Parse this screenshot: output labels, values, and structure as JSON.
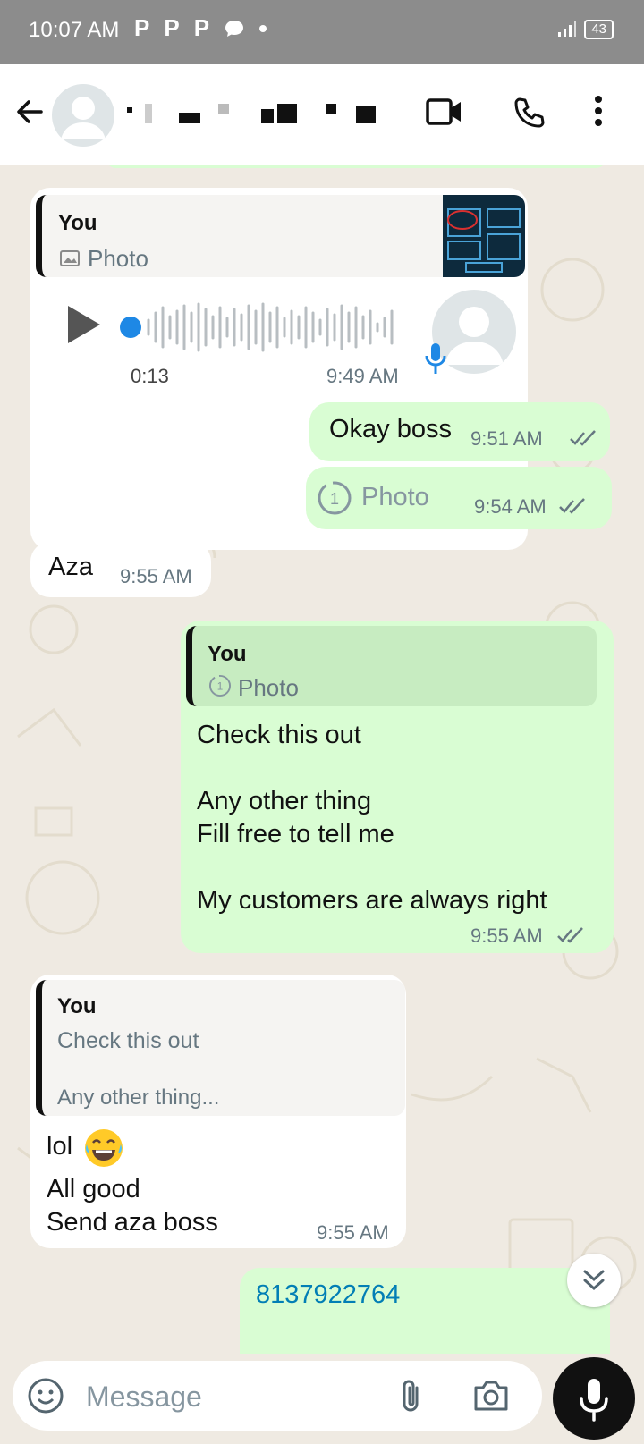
{
  "status": {
    "time": "10:07 AM",
    "notif_letter": "P",
    "battery": "43"
  },
  "header": {
    "back": "back-arrow",
    "contact_name": ""
  },
  "messages": {
    "voice": {
      "quote_author": "You",
      "quote_text": "Photo",
      "duration": "0:13",
      "time": "9:49 AM"
    },
    "okay": {
      "text": "Okay boss",
      "time": "9:51 AM"
    },
    "photo": {
      "text": "Photo",
      "time": "9:54 AM"
    },
    "aza": {
      "text": "Aza",
      "time": "9:55 AM"
    },
    "check": {
      "quote_author": "You",
      "quote_text": "Photo",
      "line1": "Check this out",
      "line2": "Any other thing",
      "line3": "Fill free to tell me",
      "line4": "My customers are always right",
      "time": "9:55 AM"
    },
    "lol": {
      "quote_author": "You",
      "quote_line1": "Check this out",
      "quote_line2": "Any other thing...",
      "line1": "lol",
      "line2": "All good",
      "line3": "Send aza boss",
      "time": "9:55 AM"
    },
    "number": {
      "text": "8137922764"
    }
  },
  "input": {
    "placeholder": "Message"
  },
  "colors": {
    "outgoing": "#d9fdd3",
    "incoming": "#ffffff",
    "wallpaper": "#efeae2",
    "link": "#027eb5"
  }
}
